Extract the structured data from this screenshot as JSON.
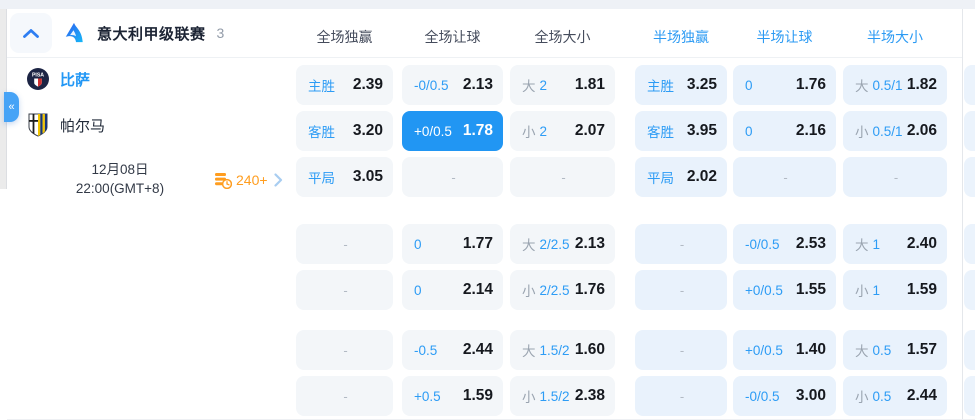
{
  "accent_color": "#2196f3",
  "highlight_color": "#2196f3",
  "header": {
    "league": "意大利甲级联赛",
    "match_count": "3",
    "columns": [
      {
        "label": "全场独赢",
        "scope": "full"
      },
      {
        "label": "全场让球",
        "scope": "full"
      },
      {
        "label": "全场大小",
        "scope": "full"
      },
      {
        "label": "半场独赢",
        "scope": "half"
      },
      {
        "label": "半场让球",
        "scope": "half"
      },
      {
        "label": "半场大小",
        "scope": "half"
      }
    ]
  },
  "match": {
    "home_team": "比萨",
    "away_team": "帕尔马",
    "date": "12月08日",
    "time": "22:00(GMT+8)",
    "more_markets": "240+",
    "collapse_tab": "«"
  },
  "dash": "-",
  "odds_rows": [
    {
      "cells": [
        {
          "label": "主胜",
          "value": "2.39"
        },
        {
          "label": "-0/0.5",
          "value": "2.13"
        },
        {
          "pre": "大",
          "line": "2",
          "value": "1.81"
        },
        {
          "label": "主胜",
          "value": "3.25"
        },
        {
          "label": "0",
          "value": "1.76"
        },
        {
          "pre": "大",
          "line": "0.5/1",
          "value": "1.82"
        }
      ]
    },
    {
      "cells": [
        {
          "label": "客胜",
          "value": "3.20"
        },
        {
          "label": "+0/0.5",
          "value": "1.78",
          "highlight": true
        },
        {
          "pre": "小",
          "line": "2",
          "value": "2.07"
        },
        {
          "label": "客胜",
          "value": "3.95"
        },
        {
          "label": "0",
          "value": "2.16"
        },
        {
          "pre": "小",
          "line": "0.5/1",
          "value": "2.06"
        }
      ]
    },
    {
      "cells": [
        {
          "label": "平局",
          "value": "3.05"
        },
        {
          "dash": true
        },
        {
          "dash": true
        },
        {
          "label": "平局",
          "value": "2.02"
        },
        {
          "dash": true
        },
        {
          "dash": true
        }
      ]
    },
    {
      "cells": [
        {
          "dash": true
        },
        {
          "label": "0",
          "value": "1.77"
        },
        {
          "pre": "大",
          "line": "2/2.5",
          "value": "2.13"
        },
        {
          "dash": true
        },
        {
          "label": "-0/0.5",
          "value": "2.53"
        },
        {
          "pre": "大",
          "line": "1",
          "value": "2.40"
        }
      ]
    },
    {
      "cells": [
        {
          "dash": true
        },
        {
          "label": "0",
          "value": "2.14"
        },
        {
          "pre": "小",
          "line": "2/2.5",
          "value": "1.76"
        },
        {
          "dash": true
        },
        {
          "label": "+0/0.5",
          "value": "1.55"
        },
        {
          "pre": "小",
          "line": "1",
          "value": "1.59"
        }
      ]
    },
    {
      "cells": [
        {
          "dash": true
        },
        {
          "label": "-0.5",
          "value": "2.44"
        },
        {
          "pre": "大",
          "line": "1.5/2",
          "value": "1.60"
        },
        {
          "dash": true
        },
        {
          "label": "+0/0.5",
          "value": "1.40"
        },
        {
          "pre": "大",
          "line": "0.5",
          "value": "1.57"
        }
      ]
    },
    {
      "cells": [
        {
          "dash": true
        },
        {
          "label": "+0.5",
          "value": "1.59"
        },
        {
          "pre": "小",
          "line": "1.5/2",
          "value": "2.38"
        },
        {
          "dash": true
        },
        {
          "label": "-0/0.5",
          "value": "3.00"
        },
        {
          "pre": "小",
          "line": "0.5",
          "value": "2.44"
        }
      ]
    }
  ]
}
